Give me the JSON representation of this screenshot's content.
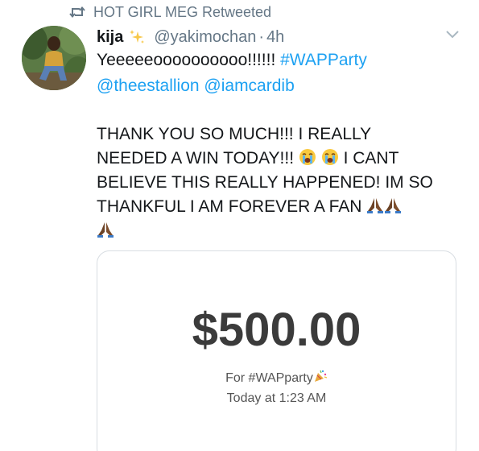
{
  "retweet": {
    "label": "HOT GIRL MEG Retweeted",
    "icon": "retweet-icon"
  },
  "author": {
    "display_name": "kija",
    "name_emoji": "sparkles-icon",
    "handle": "@yakimochan",
    "separator": "·",
    "time": "4h"
  },
  "menu": {
    "icon": "chevron-down-icon"
  },
  "body": {
    "line1_text": "Yeeeeeoooooooooo!!!!!! ",
    "line1_hashtag": "#WAPParty",
    "line2_mention1": "@theestallion",
    "line2_mention2": "@iamcardib",
    "line3": "THANK YOU SO MUCH!!! I REALLY",
    "line4_start": "NEEDED A WIN TODAY!!! ",
    "line4_end": " I CANT",
    "line5": "BELIEVE THIS REALLY HAPPENED! IM SO",
    "line6": "THANKFUL I AM FOREVER A FAN "
  },
  "payment_card": {
    "amount": "$500.00",
    "for_text": "For #WAPparty",
    "date_text": "Today at 1:23 AM"
  },
  "colors": {
    "link": "#1da1f2",
    "muted": "#657786",
    "text": "#14171a",
    "amount": "#3b3b3b"
  }
}
